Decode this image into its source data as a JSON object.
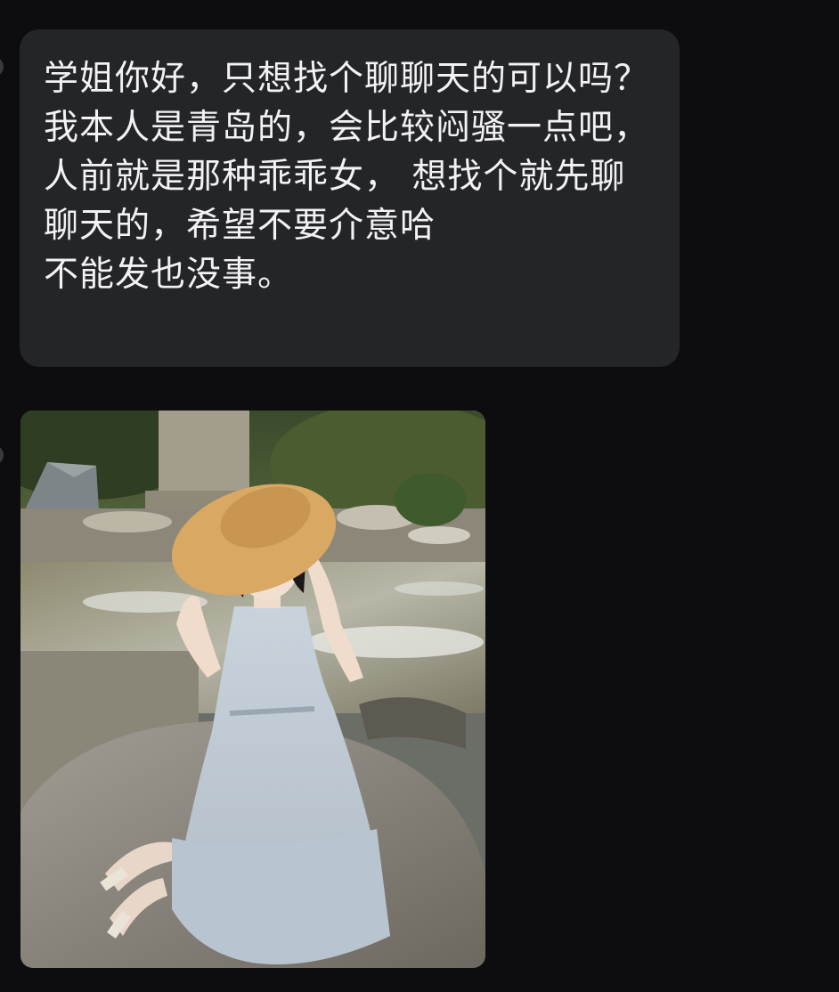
{
  "messages": [
    {
      "type": "text",
      "direction": "incoming",
      "text": "学姐你好，只想找个聊聊天的可以吗？\n我本人是青岛的，会比较闷骚一点吧，人前就是那种乖乖女， 想找个就先聊聊天的，希望不要介意哈\n不能发也没事。"
    },
    {
      "type": "image",
      "direction": "incoming",
      "content": "photo-girl-straw-hat-sitting-on-rock-by-stream"
    }
  ],
  "colors": {
    "background": "#0d0d0f",
    "bubble": "#242528",
    "text": "#f2f2f4"
  }
}
